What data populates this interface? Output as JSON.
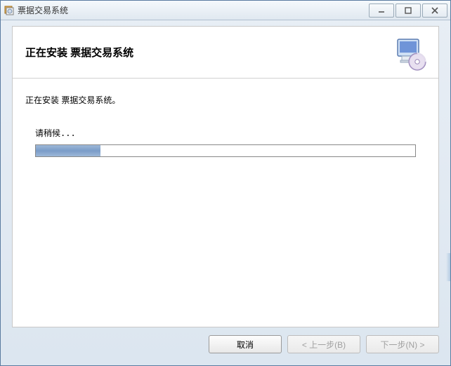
{
  "titlebar": {
    "app_name": "票据交易系统"
  },
  "header": {
    "title": "正在安装 票据交易系统"
  },
  "body": {
    "status": "正在安装 票据交易系统。",
    "wait_label": "请稍候...",
    "progress_percent": 17
  },
  "footer": {
    "cancel_label": "取消",
    "back_label": "< 上一步(B)",
    "next_label": "下一步(N) >"
  },
  "icons": {
    "installer": "installer-icon",
    "computer_disc": "computer-disc-icon"
  },
  "colors": {
    "progress_fill": "#7a9cc8",
    "window_border": "#5a7ba0"
  }
}
